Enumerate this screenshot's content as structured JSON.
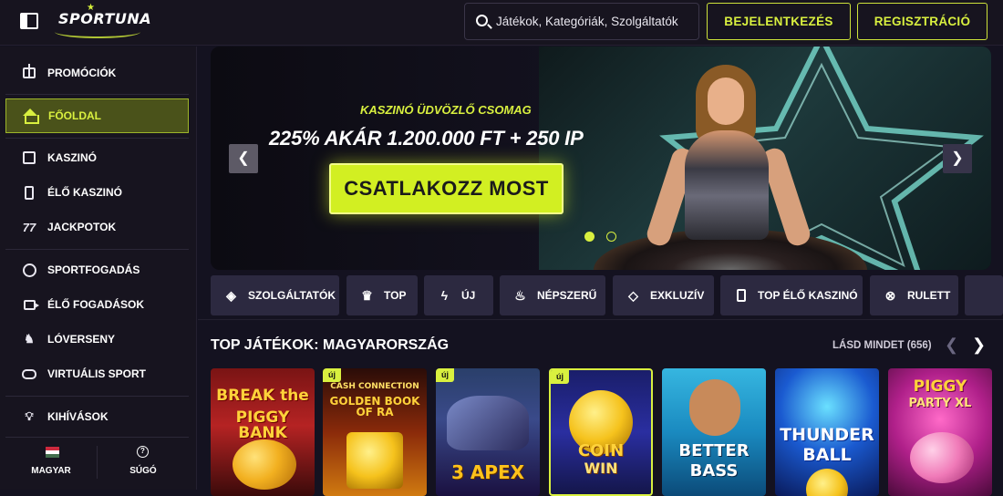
{
  "header": {
    "logo_text": "SPORTUNA",
    "search_placeholder": "Játékok, Kategóriák, Szolgáltatók",
    "login_label": "BEJELENTKEZÉS",
    "register_label": "REGISZTRÁCIÓ",
    "accent_color": "#d9f03f"
  },
  "sidebar": {
    "items": [
      {
        "label": "PROMÓCIÓK",
        "icon": "gift-icon"
      },
      {
        "label": "FŐOLDAL",
        "icon": "home-icon",
        "active": true
      },
      {
        "label": "KASZINÓ",
        "icon": "cards-icon"
      },
      {
        "label": "ÉLŐ KASZINÓ",
        "icon": "phone-icon"
      },
      {
        "label": "JACKPOTOK",
        "icon": "seven-icon"
      },
      {
        "label": "SPORTFOGADÁS",
        "icon": "soccer-ball-icon"
      },
      {
        "label": "ÉLŐ FOGADÁSOK",
        "icon": "video-camera-icon"
      },
      {
        "label": "LÓVERSENY",
        "icon": "horse-icon"
      },
      {
        "label": "VIRTUÁLIS SPORT",
        "icon": "gamepad-icon"
      },
      {
        "label": "KIHÍVÁSOK",
        "icon": "lightbulb-icon"
      }
    ],
    "footer": {
      "language_label": "MAGYAR",
      "help_label": "SÚGÓ"
    }
  },
  "hero": {
    "kicker": "KASZINÓ ÜDVÖZLŐ CSOMAG",
    "headline": "225% AKÁR 1.200.000 FT + 250 IP",
    "cta_label": "CSATLAKOZZ MOST",
    "slide_count": 2,
    "active_slide": 1
  },
  "categories": [
    {
      "label": "SZOLGÁLTATÓK",
      "icon": "layers-icon"
    },
    {
      "label": "TOP",
      "icon": "crown-icon"
    },
    {
      "label": "ÚJ",
      "icon": "lightning-icon"
    },
    {
      "label": "NÉPSZERŰ",
      "icon": "flame-icon"
    },
    {
      "label": "EXKLUZÍV",
      "icon": "diamond-icon"
    },
    {
      "label": "TOP ÉLŐ KASZINÓ",
      "icon": "phone-icon"
    },
    {
      "label": "RULETT",
      "icon": "roulette-icon"
    }
  ],
  "top_games": {
    "title": "TOP JÁTÉKOK: MAGYARORSZÁG",
    "see_all_label": "LÁSD MINDET (656)",
    "new_badge_label": "új",
    "games": [
      {
        "title_line1": "BREAK the",
        "title_line2": "PIGGY BANK",
        "is_new": false
      },
      {
        "title_line1": "CASH CONNECTION",
        "title_line2": "GOLDEN BOOK OF RA",
        "is_new": true
      },
      {
        "title_line1": "3 APEX",
        "title_line2": "",
        "is_new": true
      },
      {
        "title_line1": "COIN",
        "title_line2": "WIN",
        "is_new": true
      },
      {
        "title_line1": "BETTER",
        "title_line2": "BASS",
        "is_new": false
      },
      {
        "title_line1": "THUNDER",
        "title_line2": "BALL",
        "is_new": false
      },
      {
        "title_line1": "PIGGY",
        "title_line2": "PARTY XL",
        "is_new": false
      }
    ]
  }
}
